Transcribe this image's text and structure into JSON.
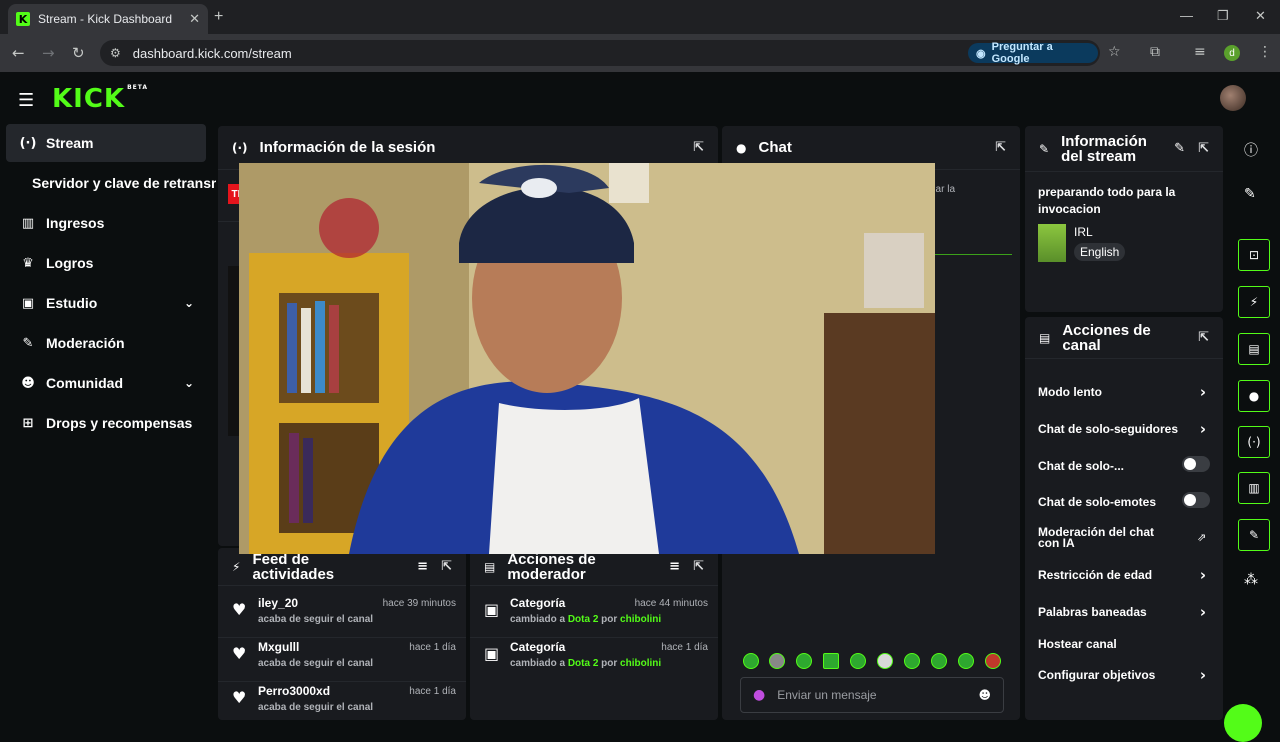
{
  "browser": {
    "tab_title": "Stream - Kick Dashboard",
    "url": "dashboard.kick.com/stream",
    "google_button": "Preguntar a Google",
    "profile_initial": "d"
  },
  "app": {
    "logo": "KICK",
    "logo_badge": "BETA"
  },
  "sidebar": {
    "items": [
      {
        "label": "Stream",
        "icon": "broadcast-icon"
      },
      {
        "label": "Servidor y clave de retransm"
      },
      {
        "label": "Ingresos",
        "icon": "chart-icon"
      },
      {
        "label": "Logros",
        "icon": "trophy-icon"
      },
      {
        "label": "Estudio",
        "icon": "studio-icon"
      },
      {
        "label": "Moderación",
        "icon": "wrench-icon"
      },
      {
        "label": "Comunidad",
        "icon": "community-icon"
      },
      {
        "label": "Drops y recompensas",
        "icon": "gift-icon"
      }
    ]
  },
  "session": {
    "title": "Información de la sesión",
    "clip_badge": "TI"
  },
  "chat": {
    "title": "Chat",
    "snippet": "nar la",
    "placeholder": "Enviar un mensaje"
  },
  "stream_info": {
    "title_line1": "Información",
    "title_line2": "del stream",
    "stream_title": "preparando todo para la invocacion",
    "category": "IRL",
    "language": "English"
  },
  "activity": {
    "title_line1": "Feed de",
    "title_line2": "actividades",
    "items": [
      {
        "name": "iley_20",
        "time": "hace 39 minutos",
        "sub": "acaba de seguir el canal"
      },
      {
        "name": "Mxgulll",
        "time": "hace 1 día",
        "sub": "acaba de seguir el canal"
      },
      {
        "name": "Perro3000xd",
        "time": "hace 1 día",
        "sub": "acaba de seguir el canal"
      }
    ]
  },
  "mod_actions": {
    "title_line1": "Acciones de",
    "title_line2": "moderador",
    "items": [
      {
        "name": "Categoría",
        "time": "hace 44 minutos",
        "sub_prefix": "cambiado a",
        "game": "Dota 2",
        "sub_mid": "por",
        "user": "chibolini"
      },
      {
        "name": "Categoría",
        "time": "hace 1 día",
        "sub_prefix": "cambiado a",
        "game": "Dota 2",
        "sub_mid": "por",
        "user": "chibolini"
      }
    ]
  },
  "channel_actions": {
    "title_line1": "Acciones de",
    "title_line2": "canal",
    "items": [
      {
        "label": "Modo lento"
      },
      {
        "label": "Chat de solo-seguidores"
      },
      {
        "label": "Chat de solo-..."
      },
      {
        "label": "Chat de solo-emotes"
      },
      {
        "label": "Moderación del chat con IA"
      },
      {
        "label": "Restricción de edad"
      },
      {
        "label": "Palabras baneadas"
      },
      {
        "label": "Hostear canal"
      },
      {
        "label": "Configurar objetivos"
      }
    ]
  },
  "colors": {
    "accent": "#53fc18",
    "panel": "#191b1f",
    "bg": "#0b0e0f"
  }
}
